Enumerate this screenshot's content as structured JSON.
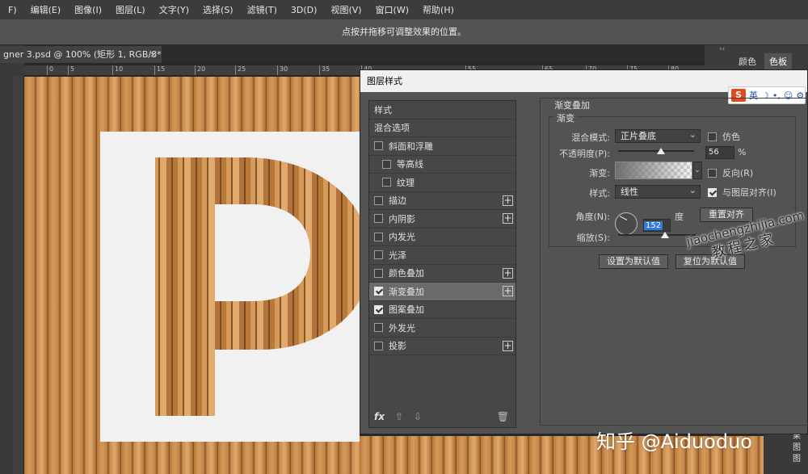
{
  "menubar": {
    "items": [
      "F)",
      "编辑(E)",
      "图像(I)",
      "图层(L)",
      "文字(Y)",
      "选择(S)",
      "滤镜(T)",
      "3D(D)",
      "视图(V)",
      "窗口(W)",
      "帮助(H)"
    ]
  },
  "optionsbar": {
    "hint": "点按并拖移可调整效果的位置。"
  },
  "document_tab": {
    "title": "gner 3.psd @ 100% (矩形 1, RGB/8*) *",
    "close": "×"
  },
  "ruler": {
    "ticks": [
      "0",
      "5",
      "10",
      "15",
      "20",
      "25",
      "30",
      "35",
      "40",
      "55",
      "65",
      "70",
      "75",
      "80",
      "85",
      "90",
      "95",
      "100"
    ]
  },
  "right_panel": {
    "collapse": "‹‹",
    "tabs": [
      "颜色",
      "色板"
    ],
    "active_tab": "色板",
    "lower_items": [
      "效果",
      "图",
      "图"
    ]
  },
  "dialog": {
    "title": "图层样式",
    "ime": {
      "logo": "S",
      "label": "英",
      "icons": [
        "☽",
        "•,",
        "☺",
        "⚙"
      ]
    },
    "style_list": [
      {
        "label": "样式",
        "checkbox": false,
        "checked": false,
        "plus": false,
        "indent": false
      },
      {
        "label": "混合选项",
        "checkbox": false,
        "checked": false,
        "plus": false,
        "indent": false
      },
      {
        "label": "斜面和浮雕",
        "checkbox": true,
        "checked": false,
        "plus": false,
        "indent": false
      },
      {
        "label": "等高线",
        "checkbox": true,
        "checked": false,
        "plus": false,
        "indent": true
      },
      {
        "label": "纹理",
        "checkbox": true,
        "checked": false,
        "plus": false,
        "indent": true
      },
      {
        "label": "描边",
        "checkbox": true,
        "checked": false,
        "plus": true,
        "indent": false
      },
      {
        "label": "内阴影",
        "checkbox": true,
        "checked": false,
        "plus": true,
        "indent": false
      },
      {
        "label": "内发光",
        "checkbox": true,
        "checked": false,
        "plus": false,
        "indent": false
      },
      {
        "label": "光泽",
        "checkbox": true,
        "checked": false,
        "plus": false,
        "indent": false
      },
      {
        "label": "颜色叠加",
        "checkbox": true,
        "checked": false,
        "plus": true,
        "indent": false
      },
      {
        "label": "渐变叠加",
        "checkbox": true,
        "checked": true,
        "plus": true,
        "indent": false,
        "selected": true
      },
      {
        "label": "图案叠加",
        "checkbox": true,
        "checked": true,
        "plus": false,
        "indent": false
      },
      {
        "label": "外发光",
        "checkbox": true,
        "checked": false,
        "plus": false,
        "indent": false
      },
      {
        "label": "投影",
        "checkbox": true,
        "checked": false,
        "plus": true,
        "indent": false
      }
    ],
    "list_footer": {
      "fx": "fx",
      "up": "⇧",
      "down": "⇩",
      "trash": "🗑"
    },
    "panel": {
      "section_title": "渐变叠加",
      "group_title": "渐变",
      "blend_mode_label": "混合模式:",
      "blend_mode_value": "正片叠底",
      "dither_label": "仿色",
      "dither_checked": false,
      "opacity_label": "不透明度(P):",
      "opacity_value": "56",
      "opacity_unit": "%",
      "opacity_level": 0.56,
      "gradient_label": "渐变:",
      "reverse_label": "反向(R)",
      "reverse_checked": false,
      "style_label": "样式:",
      "style_value": "线性",
      "align_label": "与图层对齐(I)",
      "align_checked": true,
      "angle_label": "角度(N):",
      "angle_value": "152",
      "angle_unit": "度",
      "reset_align_button": "重置对齐",
      "scale_label": "缩放(S):",
      "scale_level": 0.6,
      "set_default_button": "设置为默认值",
      "reset_default_button": "复位为默认值"
    }
  },
  "watermark": {
    "url": "jiaochengzhijia.com",
    "cn": "教程之家"
  },
  "credit": {
    "text": "知乎 @Aiduoduo"
  }
}
